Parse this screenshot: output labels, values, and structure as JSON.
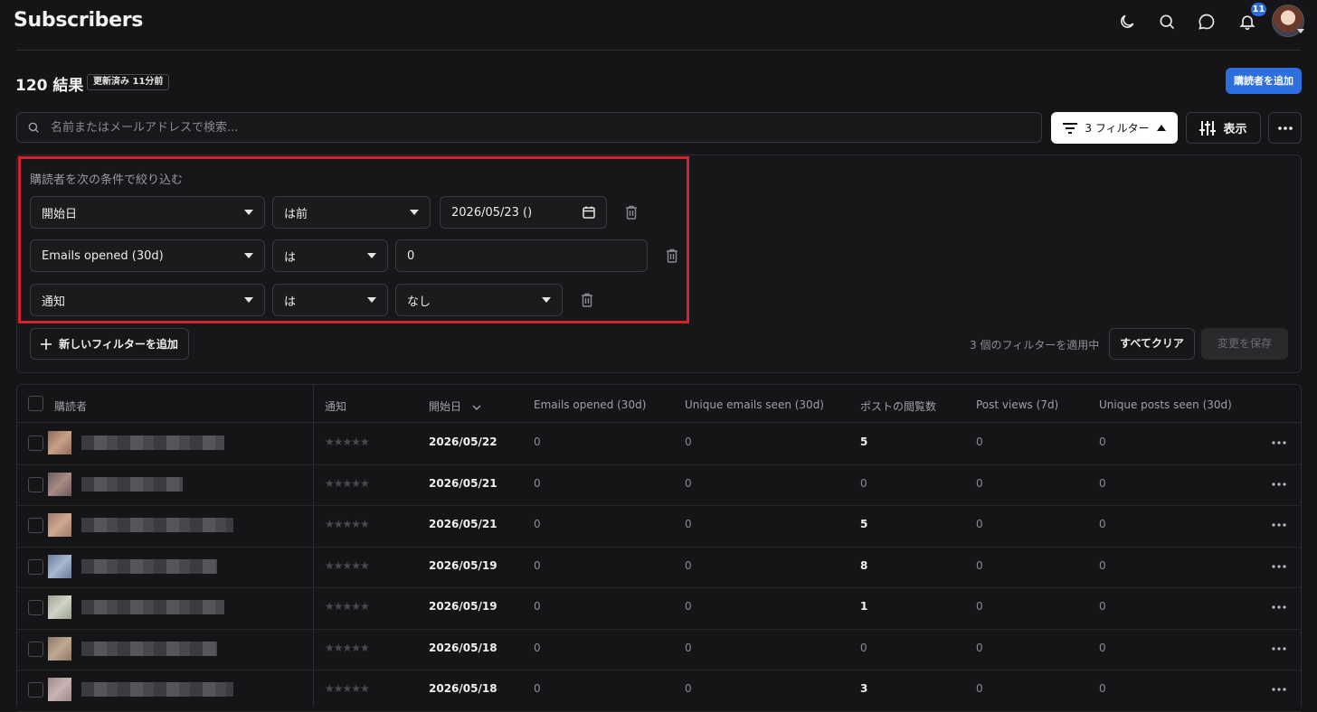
{
  "header": {
    "title": "Subscribers",
    "notification_count": "11",
    "icons": [
      "moon-icon",
      "search-icon",
      "chat-icon",
      "bell-icon",
      "avatar"
    ]
  },
  "summary": {
    "result_count": "120 結果",
    "updated_badge": "更新済み 11分前",
    "add_subscriber_label": "購読者を追加"
  },
  "search": {
    "placeholder": "名前またはメールアドレスで検索..."
  },
  "toolbar": {
    "filters_label": "3 フィルター",
    "display_label": "表示"
  },
  "filter_panel": {
    "heading": "購読者を次の条件で絞り込む",
    "rows": [
      {
        "field": "開始日",
        "operator": "は前",
        "value": "2026/05/23 ()"
      },
      {
        "field": "Emails opened (30d)",
        "operator": "は",
        "value": "0"
      },
      {
        "field": "通知",
        "operator": "は",
        "value": "なし"
      }
    ],
    "add_filter_label": "新しいフィルターを追加",
    "applied_text": "3 個のフィルターを適用中",
    "clear_label": "すべてクリア",
    "save_label": "変更を保存"
  },
  "table": {
    "headers": [
      "購読者",
      "通知",
      "開始日",
      "Emails opened (30d)",
      "Unique emails seen (30d)",
      "ポストの閲覧数",
      "Post views (7d)",
      "Unique posts seen (30d)"
    ],
    "rows": [
      {
        "stars": "★★★★★",
        "date": "2026/05/22",
        "emails_opened": "0",
        "unique_emails": "0",
        "post_views_total": "5",
        "post_views_7d": "0",
        "unique_posts": "0"
      },
      {
        "stars": "★★★★★",
        "date": "2026/05/21",
        "emails_opened": "0",
        "unique_emails": "0",
        "post_views_total": "0",
        "post_views_7d": "0",
        "unique_posts": "0"
      },
      {
        "stars": "★★★★★",
        "date": "2026/05/21",
        "emails_opened": "0",
        "unique_emails": "0",
        "post_views_total": "5",
        "post_views_7d": "0",
        "unique_posts": "0"
      },
      {
        "stars": "★★★★★",
        "date": "2026/05/19",
        "emails_opened": "0",
        "unique_emails": "0",
        "post_views_total": "8",
        "post_views_7d": "0",
        "unique_posts": "0"
      },
      {
        "stars": "★★★★★",
        "date": "2026/05/19",
        "emails_opened": "0",
        "unique_emails": "0",
        "post_views_total": "1",
        "post_views_7d": "0",
        "unique_posts": "0"
      },
      {
        "stars": "★★★★★",
        "date": "2026/05/18",
        "emails_opened": "0",
        "unique_emails": "0",
        "post_views_total": "0",
        "post_views_7d": "0",
        "unique_posts": "0"
      },
      {
        "stars": "★★★★★",
        "date": "2026/05/18",
        "emails_opened": "0",
        "unique_emails": "0",
        "post_views_total": "3",
        "post_views_7d": "0",
        "unique_posts": "0"
      }
    ]
  },
  "colors": {
    "background": "#151517",
    "accent": "#2e6fe0",
    "highlight_border": "#d42330"
  }
}
